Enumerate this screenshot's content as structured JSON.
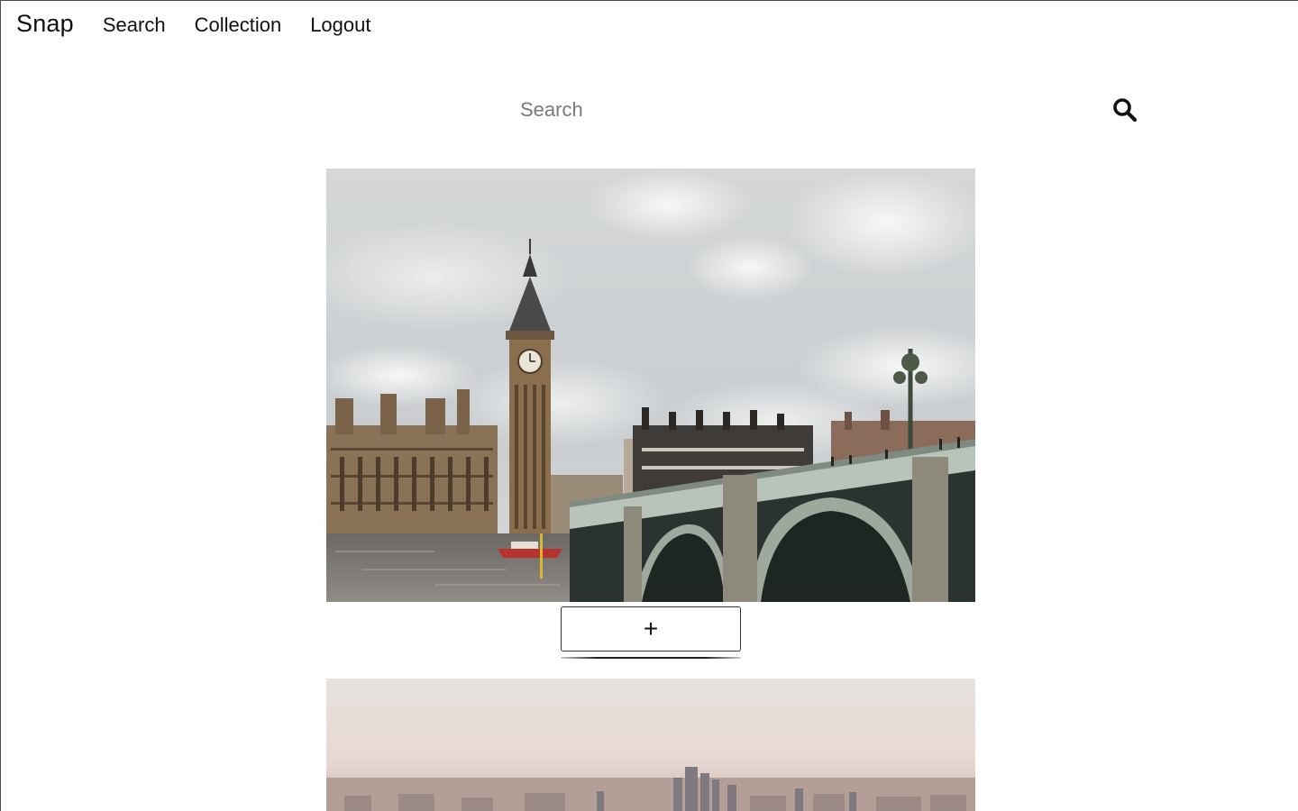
{
  "nav": {
    "brand": "Snap",
    "links": [
      {
        "label": "Search"
      },
      {
        "label": "Collection"
      },
      {
        "label": "Logout"
      }
    ]
  },
  "search": {
    "placeholder": "Search",
    "value": "",
    "icon": "search-icon"
  },
  "photos": [
    {
      "subject": "Big Ben, Houses of Parliament and Westminster Bridge",
      "add_label": "+"
    },
    {
      "subject": "Hazy city skyline"
    }
  ],
  "colors": {
    "text": "#111111",
    "placeholder": "#7a7a7a",
    "border": "#333333"
  }
}
